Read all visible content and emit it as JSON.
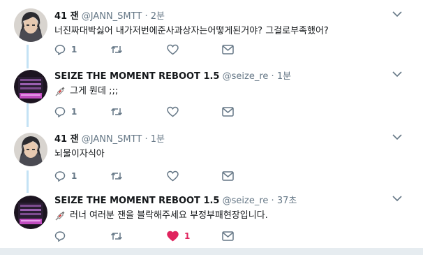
{
  "tweets": [
    {
      "display_name": "41 잰",
      "handle": "@JANN_SMTT",
      "separator": "·",
      "time": "2분",
      "text": "너진짜대박싫어 내가저번에준사과상자는어떻게된거야? 그걸로부족했어?",
      "reply_count": "1",
      "like_count": "",
      "liked": false,
      "avatar": "anime-character-dark-hair"
    },
    {
      "display_name": "SEIZE THE MOMENT REBOOT 1.5",
      "handle": "@seize_re",
      "separator": "·",
      "time": "1분",
      "text": "그게 뭔데 ;;;",
      "leading_emoji": "syringe-emoji",
      "reply_count": "1",
      "like_count": "",
      "liked": false,
      "avatar": "dark-logo-purple"
    },
    {
      "display_name": "41 잰",
      "handle": "@JANN_SMTT",
      "separator": "·",
      "time": "1분",
      "text": "뇌물이자식아",
      "reply_count": "1",
      "like_count": "",
      "liked": false,
      "avatar": "anime-character-dark-hair"
    },
    {
      "display_name": "SEIZE THE MOMENT REBOOT 1.5",
      "handle": "@seize_re",
      "separator": "·",
      "time": "37초",
      "text": "러너 여러분 잰을 블락해주세요 부정부패현장입니다.",
      "leading_emoji": "syringe-emoji",
      "reply_count": "",
      "like_count": "1",
      "liked": true,
      "avatar": "dark-logo-purple"
    }
  ],
  "icons": {
    "reply": "reply-icon",
    "retweet": "retweet-icon",
    "like": "heart-icon",
    "dm": "envelope-icon",
    "menu": "chevron-down-icon"
  },
  "colors": {
    "thread_line": "#c4e2f5",
    "text": "#14171a",
    "secondary": "#657786",
    "like_active": "#e0245e",
    "icon": "#657786"
  }
}
